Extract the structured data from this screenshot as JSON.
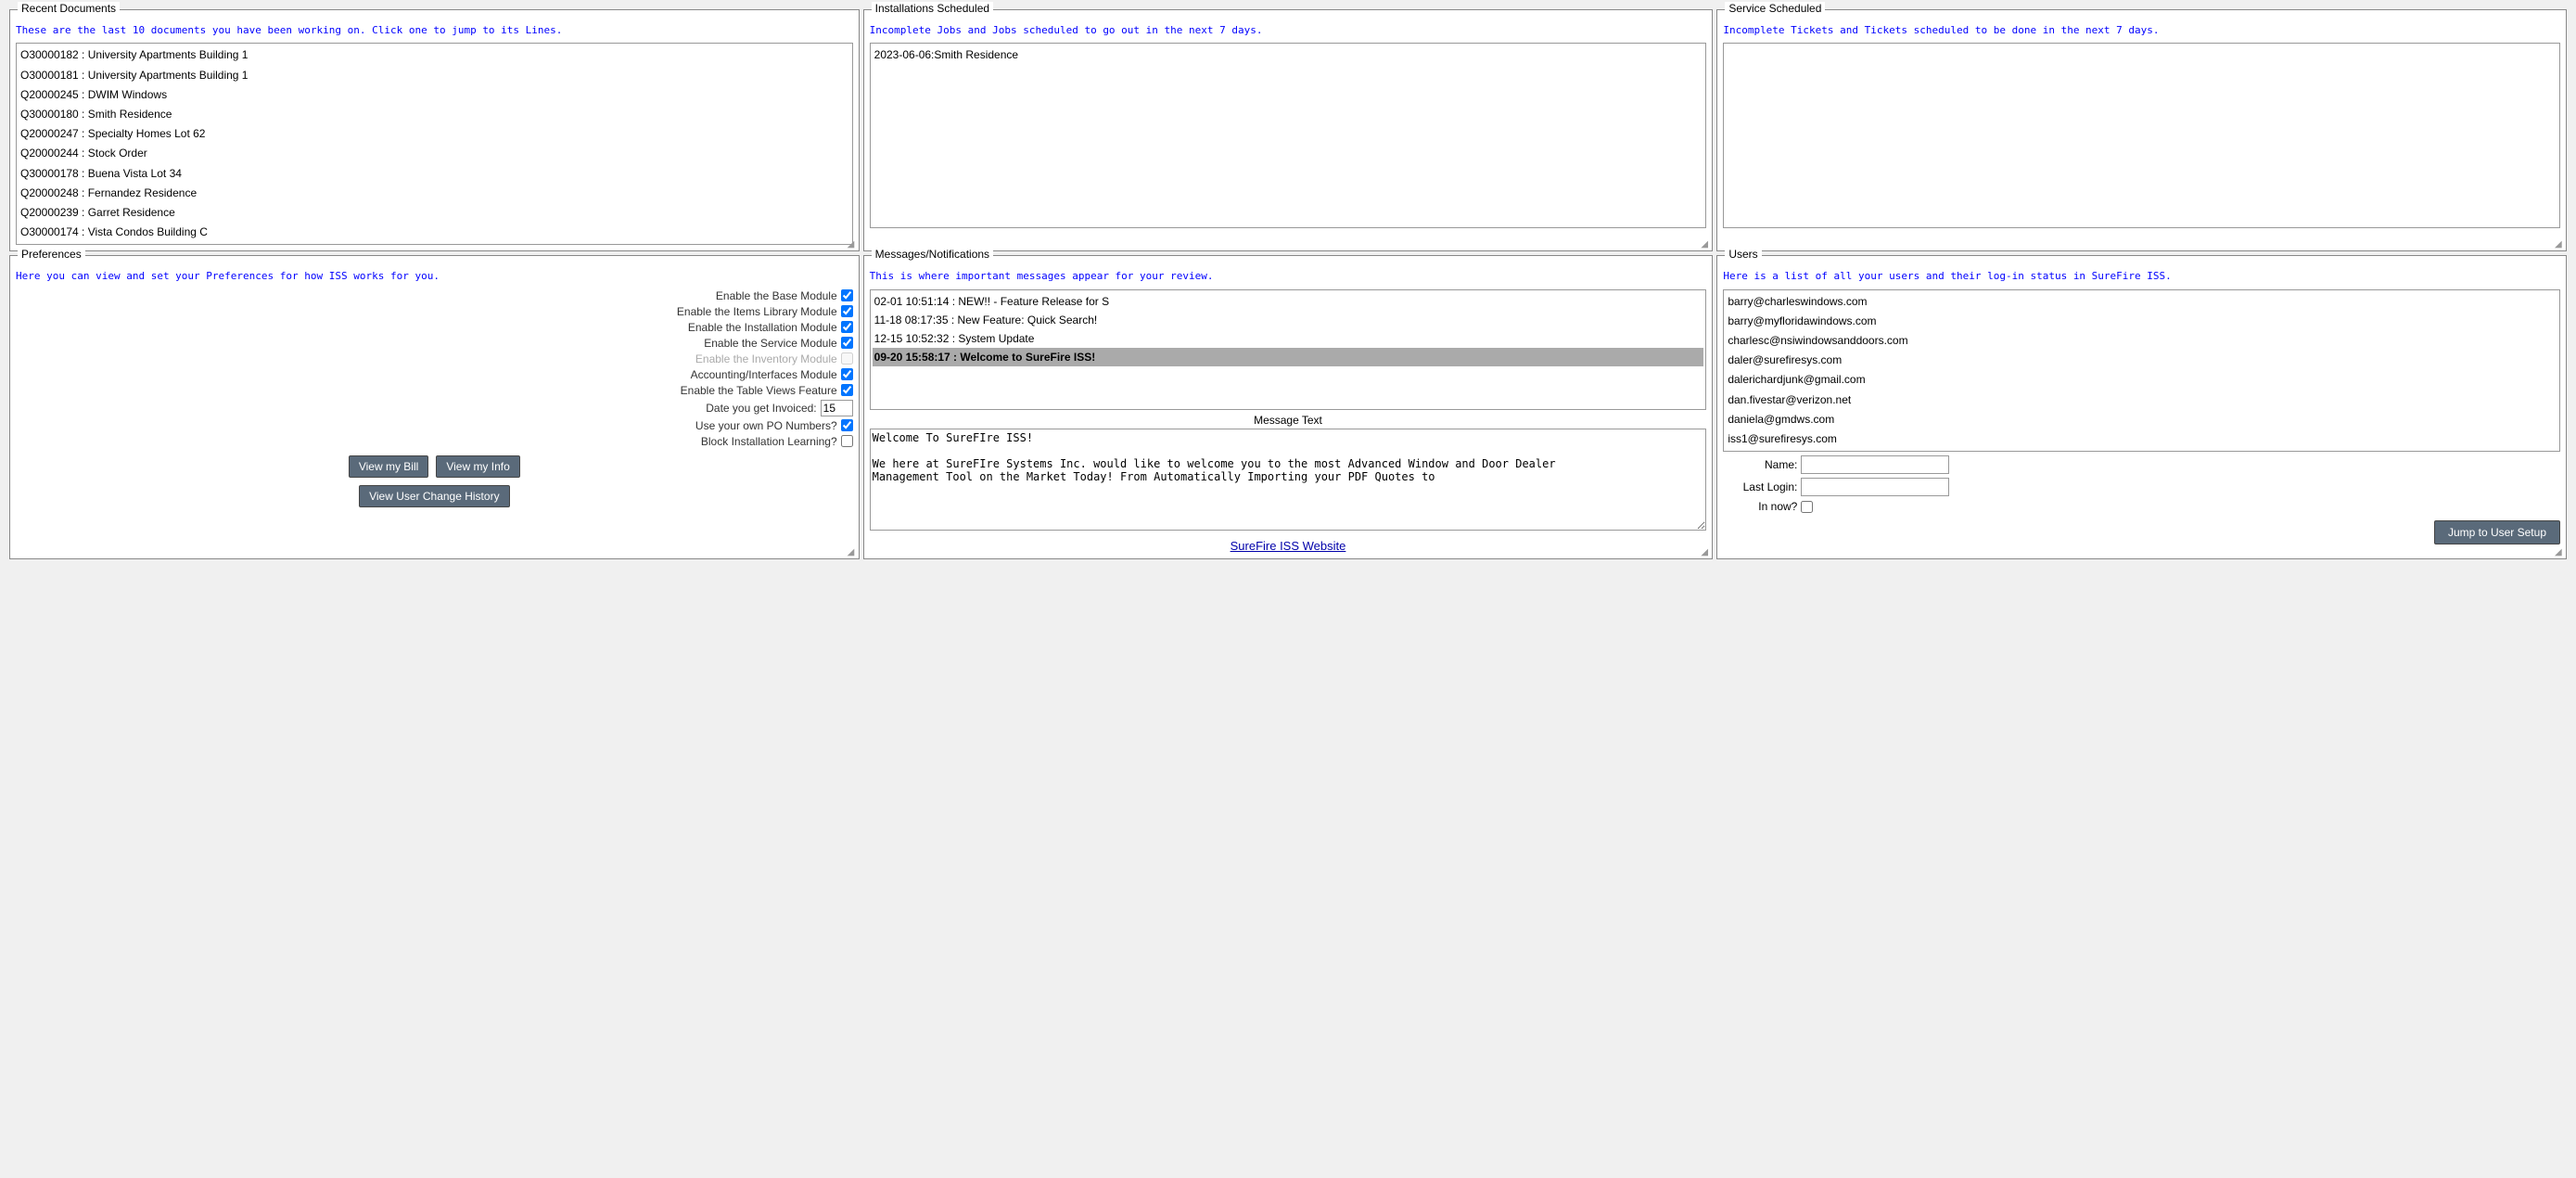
{
  "recentDocuments": {
    "title": "Recent Documents",
    "infoText": "These are the last 10 documents you have been working on. Click one to jump to its Lines.",
    "items": [
      "O30000182 : University Apartments Building 1",
      "O30000181 : University Apartments Building 1",
      "Q20000245 : DWIM Windows",
      "Q30000180 : Smith Residence",
      "Q20000247 : Specialty Homes Lot 62",
      "Q20000244 : Stock Order",
      "Q30000178 : Buena Vista Lot 34",
      "Q20000248 : Fernandez Residence",
      "Q20000239 : Garret Residence",
      "O30000174 : Vista Condos Building C"
    ]
  },
  "installationsScheduled": {
    "title": "Installations Scheduled",
    "infoText": "Incomplete Jobs and Jobs scheduled to go out in the next 7 days.",
    "items": [
      "2023-06-06:Smith Residence"
    ]
  },
  "serviceScheduled": {
    "title": "Service Scheduled",
    "infoText": "Incomplete Tickets and Tickets scheduled to be done in the next 7 days.",
    "items": []
  },
  "preferences": {
    "title": "Preferences",
    "infoText": "Here you can view and set your Preferences for how ISS works for you.",
    "fields": [
      {
        "label": "Enable the Base Module",
        "checked": true,
        "disabled": false,
        "type": "checkbox"
      },
      {
        "label": "Enable the Items Library Module",
        "checked": true,
        "disabled": false,
        "type": "checkbox"
      },
      {
        "label": "Enable the Installation Module",
        "checked": true,
        "disabled": false,
        "type": "checkbox"
      },
      {
        "label": "Enable the Service Module",
        "checked": true,
        "disabled": false,
        "type": "checkbox"
      },
      {
        "label": "Enable the Inventory Module",
        "checked": false,
        "disabled": true,
        "type": "checkbox"
      },
      {
        "label": "Accounting/Interfaces Module",
        "checked": true,
        "disabled": false,
        "type": "checkbox"
      },
      {
        "label": "Enable the Table Views Feature",
        "checked": true,
        "disabled": false,
        "type": "checkbox"
      },
      {
        "label": "Date you get Invoiced:",
        "value": "15",
        "type": "text"
      },
      {
        "label": "Use your own PO Numbers?",
        "checked": true,
        "disabled": false,
        "type": "checkbox"
      },
      {
        "label": "Block Installation Learning?",
        "checked": false,
        "disabled": false,
        "type": "checkbox"
      }
    ],
    "buttons": [
      {
        "label": "View my Bill",
        "name": "view-my-bill-button"
      },
      {
        "label": "View my Info",
        "name": "view-my-info-button"
      }
    ],
    "secondRowButton": {
      "label": "View User Change History",
      "name": "view-user-change-history-button"
    }
  },
  "messages": {
    "title": "Messages/Notifications",
    "infoText": "This is where important messages appear for your review.",
    "items": [
      {
        "text": "02-01 10:51:14 : NEW!! - Feature Release for S",
        "selected": false
      },
      {
        "text": "11-18 08:17:35 : New Feature: Quick Search!",
        "selected": false
      },
      {
        "text": "12-15 10:52:32 : System Update",
        "selected": false
      },
      {
        "text": "09-20 15:58:17 : Welcome to SureFire ISS!",
        "selected": true
      }
    ],
    "messageTextLabel": "Message Text",
    "messageBody": "Welcome To SureFIre ISS!\n\nWe here at SureFIre Systems Inc. would like to welcome you to the most Advanced Window and Door Dealer\nManagement Tool on the Market Today! From Automatically Importing your PDF Quotes to",
    "surefireLink": "SureFire ISS Website"
  },
  "users": {
    "title": "Users",
    "infoText": "Here is a list of all your users and their log-in status in SureFire ISS.",
    "items": [
      "barry@charleswindows.com",
      "barry@myfloridawindows.com",
      "charlesc@nsiwindowsanddoors.com",
      "daler@surefiresys.com",
      "dalerichardjunk@gmail.com",
      "dan.fivestar@verizon.net",
      "daniela@gmdws.com",
      "iss1@surefiresys.com"
    ],
    "nameLabel": "Name:",
    "lastLoginLabel": "Last Login:",
    "inNowLabel": "In now?",
    "jumpToUserSetupLabel": "Jump to User Setup"
  }
}
